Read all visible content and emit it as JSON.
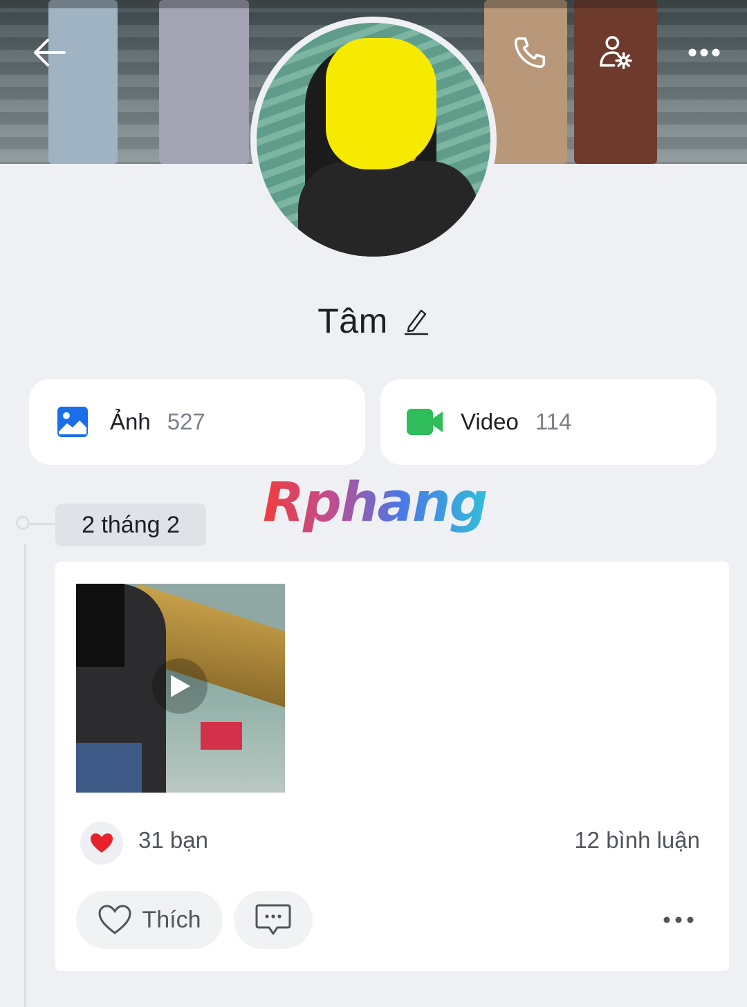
{
  "header": {
    "back_icon": "arrow-left-icon",
    "call_icon": "phone-icon",
    "settings_icon": "user-settings-icon",
    "more_icon": "more-horizontal-icon"
  },
  "profile": {
    "name": "Tâm",
    "edit_icon": "pencil-icon"
  },
  "media": {
    "photos": {
      "label": "Ảnh",
      "count": "527",
      "icon": "image-icon",
      "color": "#1a6fe8"
    },
    "videos": {
      "label": "Video",
      "count": "114",
      "icon": "video-camera-icon",
      "color": "#2ebd59"
    }
  },
  "watermark": {
    "text": "Rphang"
  },
  "timeline": {
    "date": "2 tháng 2",
    "post": {
      "media_type": "video",
      "reactions": {
        "icon": "heart-icon",
        "count_text": "31 bạn"
      },
      "comments_text": "12 bình luận",
      "like_label": "Thích",
      "comment_icon": "chat-bubble-icon",
      "more_icon": "more-horizontal-icon"
    }
  }
}
